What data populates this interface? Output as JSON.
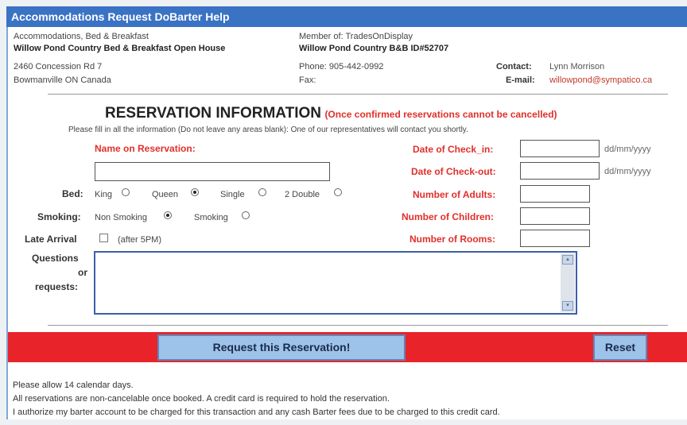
{
  "window": {
    "title": "Accommodations Request DoBarter Help"
  },
  "listing": {
    "category": "Accommodations, Bed & Breakfast",
    "name": "Willow Pond Country Bed & Breakfast Open House",
    "address1": "2460 Concession Rd 7",
    "address2": "Bowmanville ON Canada",
    "member_of": "Member of: TradesOnDisplay",
    "member_name": "Willow Pond Country B&B ID#52707",
    "phone": "Phone: 905-442-0992",
    "fax": "Fax:",
    "contact_label": "Contact:",
    "contact_value": "Lynn Morrison",
    "email_label": "E-mail:",
    "email_value": "willowpond@sympatico.ca"
  },
  "reservation": {
    "heading": "RESERVATION INFORMATION",
    "note": "(Once confirmed reservations cannot be cancelled)",
    "instructions": "Please fill in all the information (Do not leave any areas blank): One of our representatives will contact you shortly.",
    "name_label": "Name on Reservation:",
    "bed_label": "Bed:",
    "bed_options": [
      "King",
      "Queen",
      "Single",
      "2 Double"
    ],
    "bed_selected": "Queen",
    "smoking_label": "Smoking:",
    "smoking_options": [
      "Non Smoking",
      "Smoking"
    ],
    "smoking_selected": "Non Smoking",
    "late_label": "Late Arrival",
    "late_hint": "(after 5PM)",
    "questions_label1": "Questions",
    "questions_label2": "or",
    "questions_label3": "requests:",
    "checkin_label": "Date of Check_in:",
    "checkout_label": "Date of Check-out:",
    "date_format": "dd/mm/yyyy",
    "adults_label": "Number of Adults:",
    "children_label": "Number of Children:",
    "rooms_label": "Number of Rooms:"
  },
  "actions": {
    "request_label": "Request this Reservation!",
    "reset_label": "Reset"
  },
  "footer": {
    "line1": "Please allow 14 calendar days.",
    "line2": "All reservations are non-cancelable once booked. A credit card is required to hold the reservation.",
    "line3": "I authorize my barter account to be charged for this transaction and any cash Barter fees due to be charged to this credit card."
  },
  "colors": {
    "titlebar": "#3a72c4",
    "accent_red": "#e0302b",
    "button_bg": "#9ec3ea",
    "bar_red": "#e8242a"
  }
}
